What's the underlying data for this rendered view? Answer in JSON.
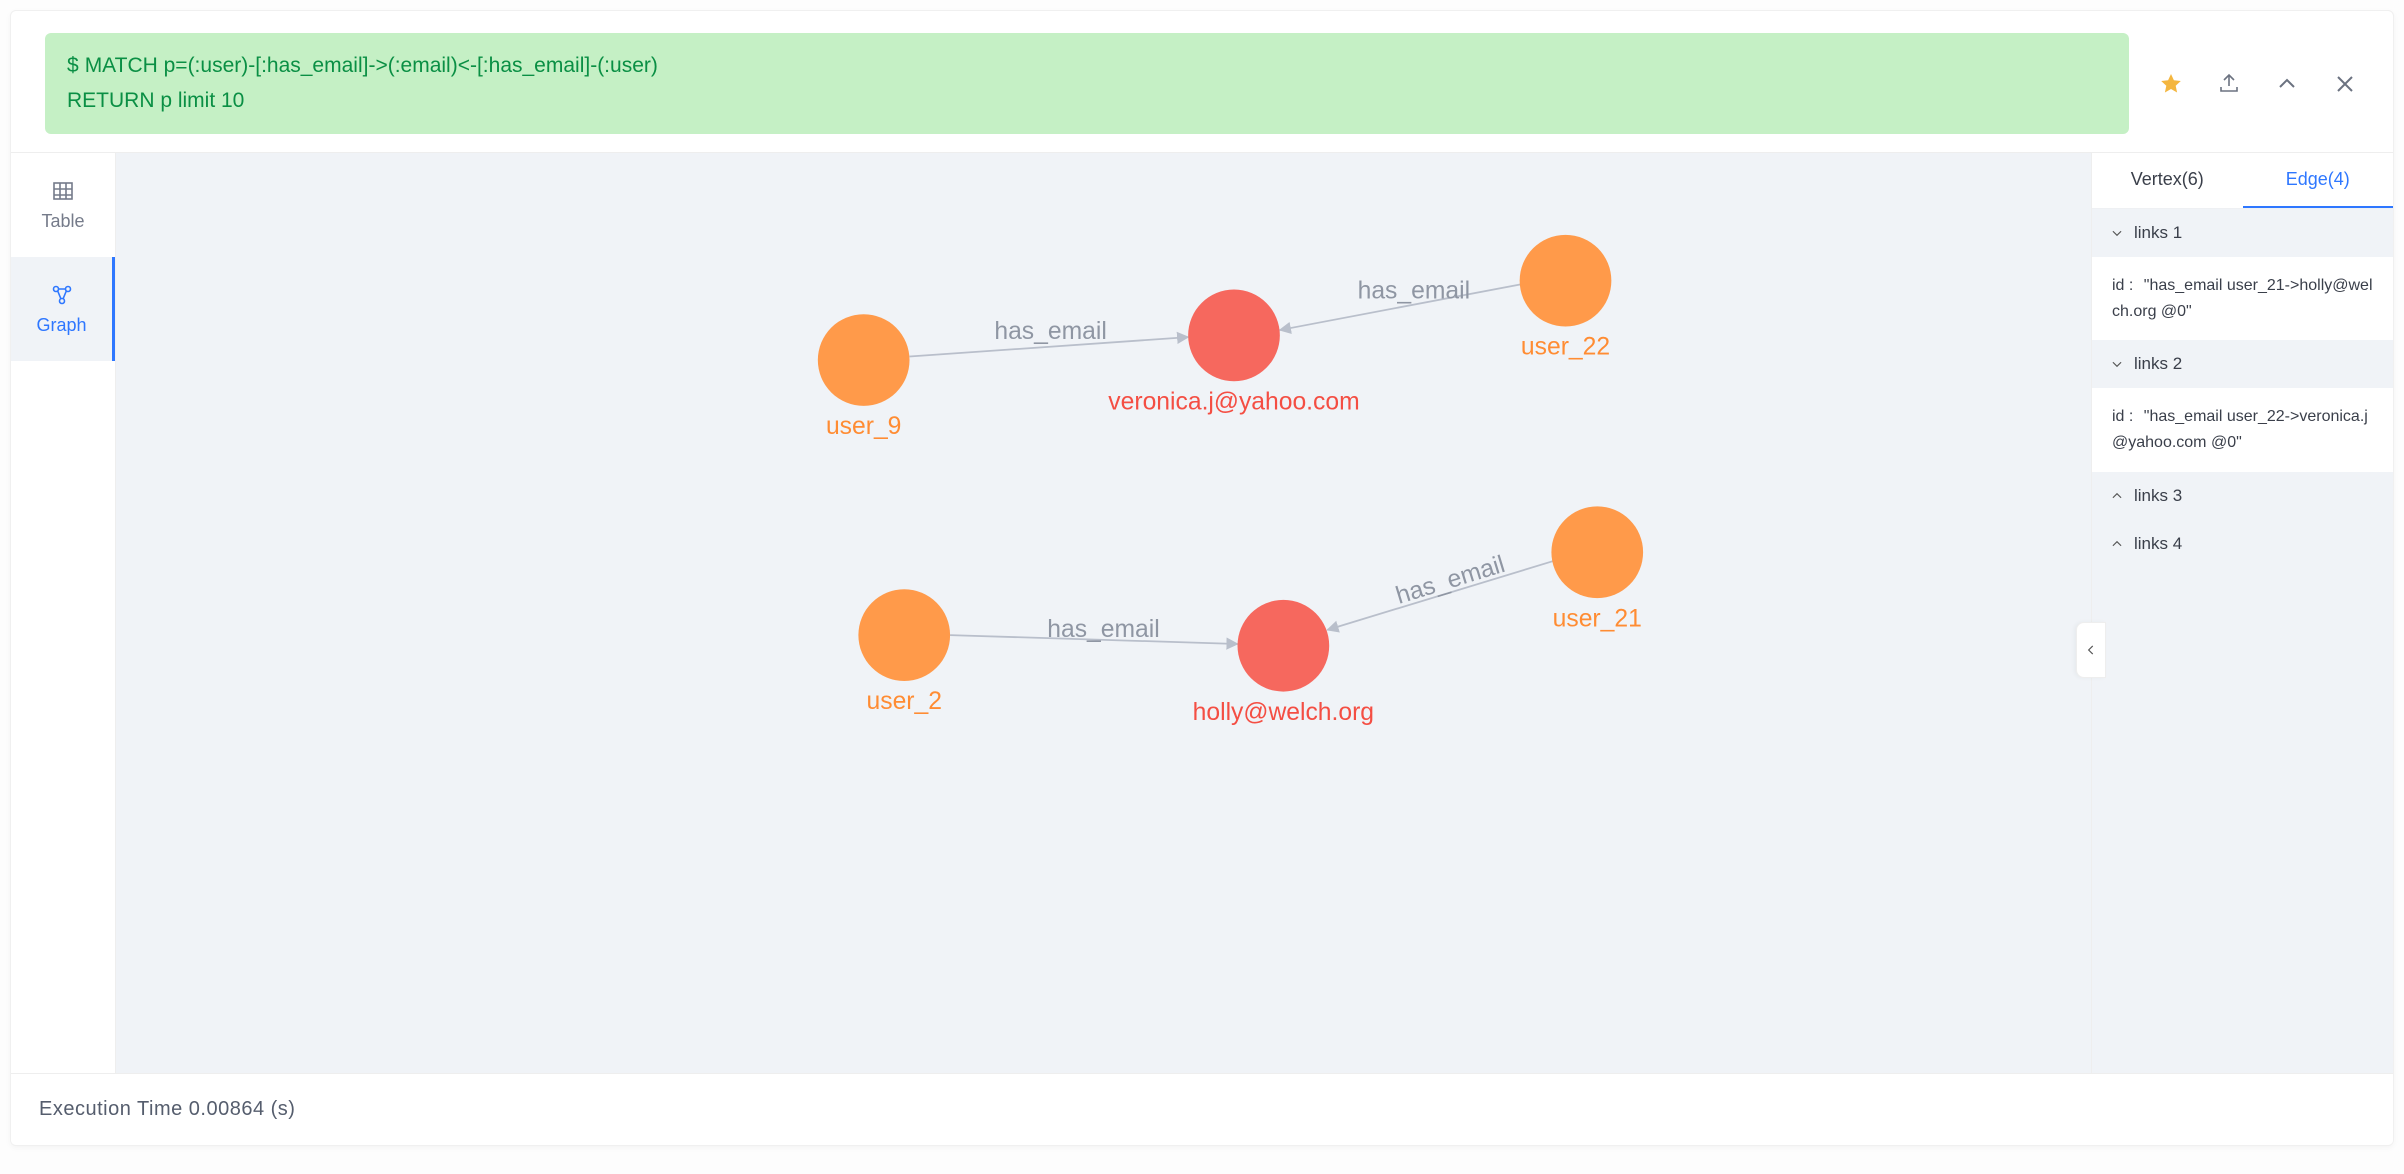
{
  "query": {
    "prompt": "$",
    "line1": "MATCH p=(:user)-[:has_email]->(:email)<-[:has_email]-(:user)",
    "line2": "RETURN p limit 10"
  },
  "viewTabs": {
    "table": "Table",
    "graph": "Graph"
  },
  "graph": {
    "nodes": {
      "user_9": "user_9",
      "user_22": "user_22",
      "user_2": "user_2",
      "user_21": "user_21",
      "veronica": "veronica.j@yahoo.com",
      "holly": "holly@welch.org"
    },
    "edges": {
      "e1": "has_email",
      "e2": "has_email",
      "e3": "has_email",
      "e4": "has_email"
    }
  },
  "sidePanel": {
    "vertexTab": "Vertex(6)",
    "edgeTab": "Edge(4)",
    "idLabel": "id :",
    "items": [
      {
        "title": "links 1",
        "expanded": true,
        "id": "\"has_email user_21->holly@welch.org @0\""
      },
      {
        "title": "links 2",
        "expanded": true,
        "id": "\"has_email user_22->veronica.j@yahoo.com @0\""
      },
      {
        "title": "links 3",
        "expanded": false,
        "id": ""
      },
      {
        "title": "links 4",
        "expanded": false,
        "id": ""
      }
    ]
  },
  "footer": {
    "label": "Execution Time 0.00864 (s)"
  }
}
